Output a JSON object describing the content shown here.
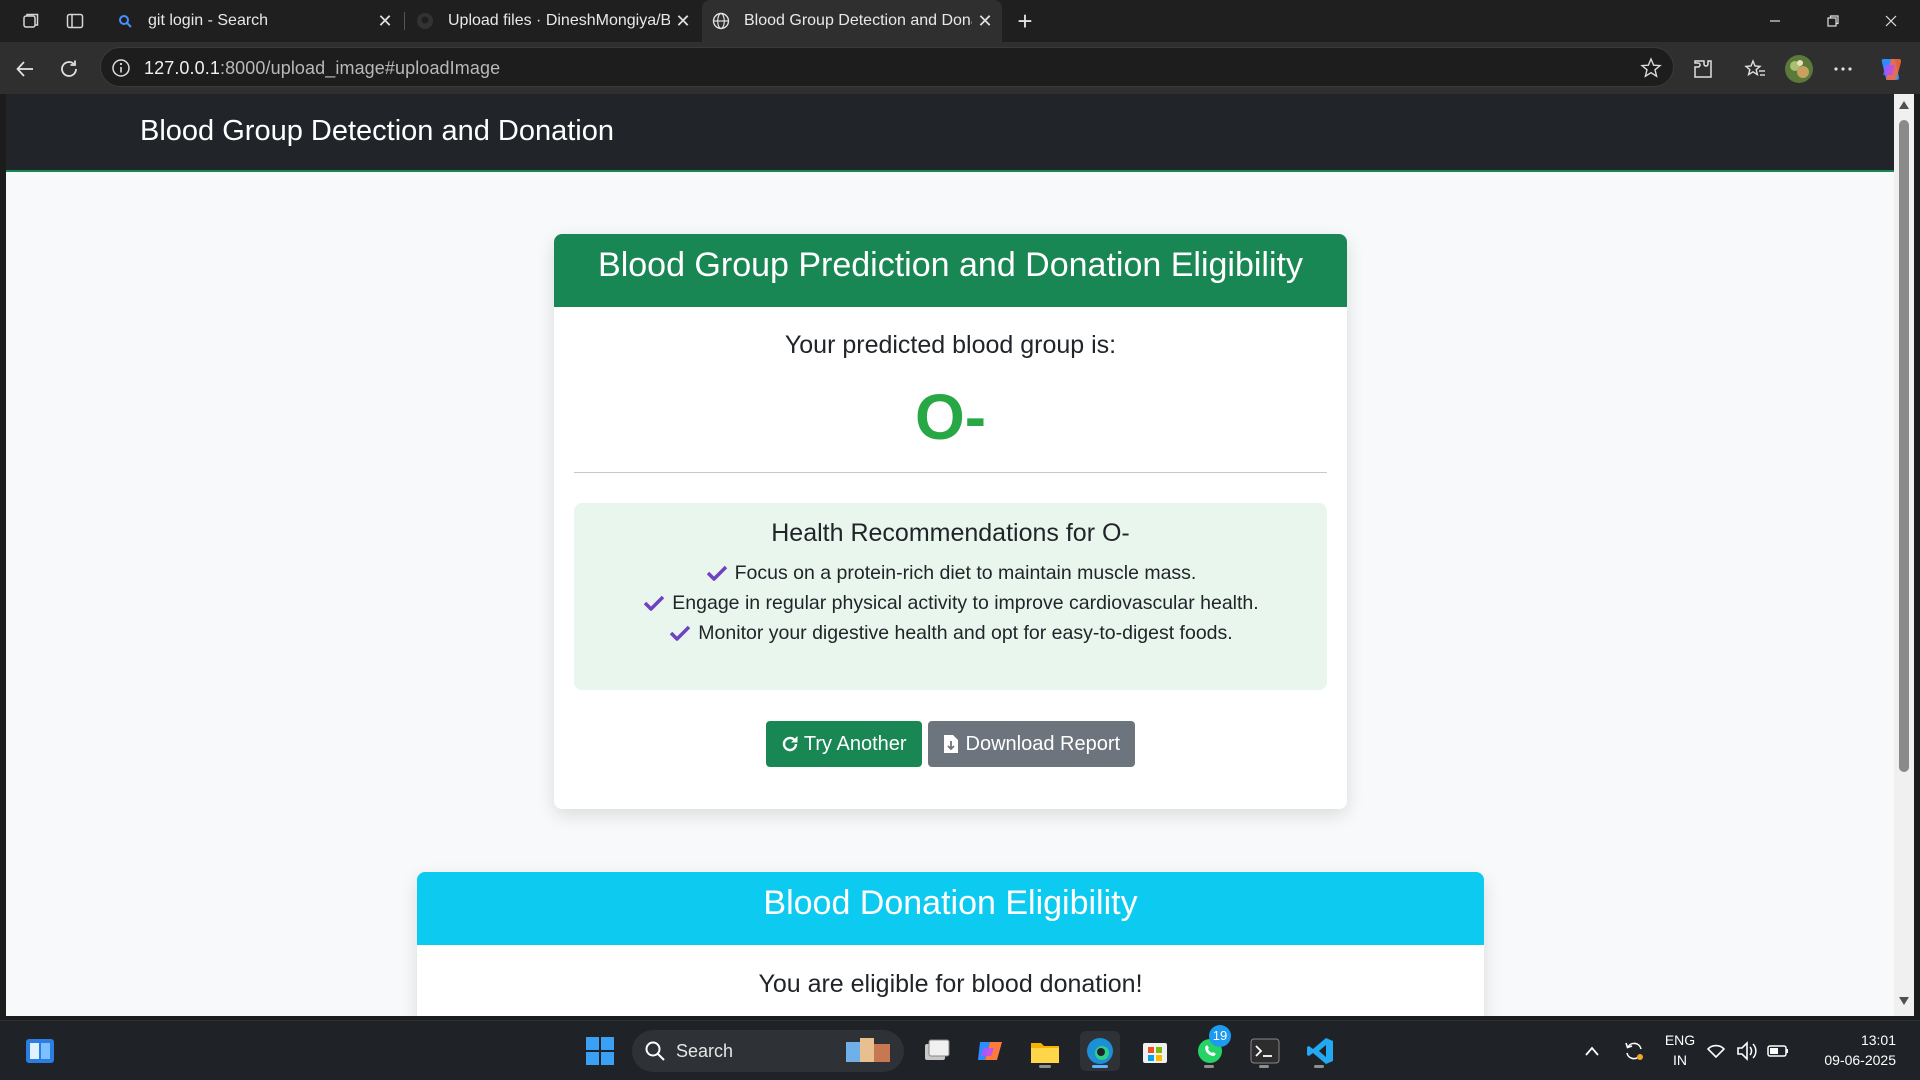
{
  "browser": {
    "tabs": [
      {
        "title": "git login - Search",
        "active": false
      },
      {
        "title": "Upload files · DineshMongiya/Blo",
        "active": false
      },
      {
        "title": "Blood Group Detection and Dona",
        "active": true
      }
    ],
    "url_host": "127.0.0.1",
    "url_path": ":8000/upload_image#uploadImage"
  },
  "page": {
    "brand": "Blood Group Detection and Donation",
    "prediction_card": {
      "header": "Blood Group Prediction and Donation Eligibility",
      "predicted_label": "Your predicted blood group is:",
      "blood_group": "O-",
      "recommendations_title": "Health Recommendations for O-",
      "recommendations": [
        "Focus on a protein-rich diet to maintain muscle mass.",
        "Engage in regular physical activity to improve cardiovascular health.",
        "Monitor your digestive health and opt for easy-to-digest foods."
      ],
      "try_another_label": "Try Another",
      "download_label": "Download Report"
    },
    "donation_card": {
      "header": "Blood Donation Eligibility",
      "message": "You are eligible for blood donation!"
    }
  },
  "taskbar": {
    "search_label": "Search",
    "whatsapp_badge": "19",
    "language": "ENG",
    "region": "IN",
    "time": "13:01",
    "date": "09-06-2025"
  },
  "colors": {
    "success": "#198754",
    "predicted_text": "#28a745",
    "info": "#0dcaf0",
    "secondary": "#6c757d",
    "navbar": "#212529",
    "check": "#6f42c1"
  }
}
